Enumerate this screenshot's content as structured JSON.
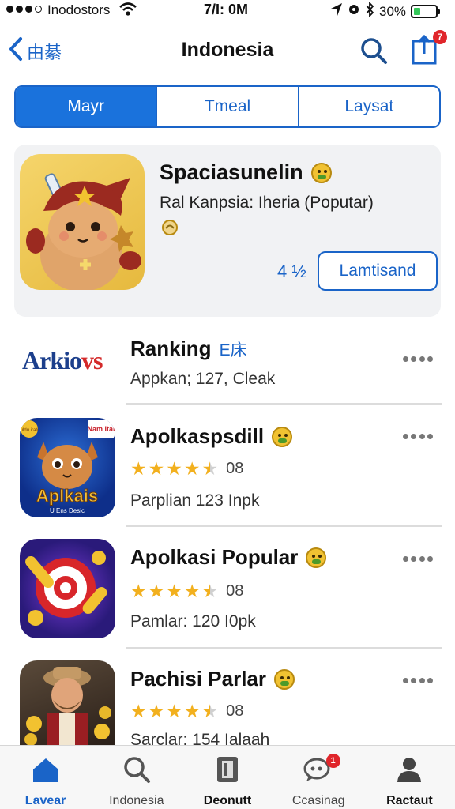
{
  "status_bar": {
    "carrier": "Inodostors",
    "time": "7/I: 0M",
    "battery": "30%",
    "battery_level": 0.3
  },
  "nav": {
    "back_label": "由綦",
    "title": "Indonesia",
    "share_badge": "7"
  },
  "segments": [
    {
      "label": "Mayr",
      "active": true
    },
    {
      "label": "Tmeal",
      "active": false
    },
    {
      "label": "Laysat",
      "active": false
    }
  ],
  "featured": {
    "title": "Spaciasunelin",
    "subtitle": "Ral Kanpsia:  Iheria (Poputar)",
    "rating": "4 ½",
    "button_label": "Lamtisand"
  },
  "list": [
    {
      "title": "Ranking",
      "tag": "E床",
      "subtitle": "Appkan; 127, Cleak",
      "logo_text_blue": "Arkio",
      "logo_text_red": "vs"
    },
    {
      "title": "Apolkaspsdill",
      "rating": 4.5,
      "count": "08",
      "subtitle": "Parplian 123  Inpk",
      "icon_text": "Aplkais",
      "icon_badge": "Nam Itai",
      "icon_corner": "uldu irati",
      "icon_caption": "U Ens Desic"
    },
    {
      "title": "Apolkasi Popular",
      "rating": 4.5,
      "count": "08",
      "subtitle": "Pamlar:  120  I0pk"
    },
    {
      "title": "Pachisi Parlar",
      "rating": 4.5,
      "count": "08",
      "subtitle": "Sarclar:  154  Ialaah"
    }
  ],
  "tabs": [
    {
      "label": "Lavear",
      "icon": "home-icon"
    },
    {
      "label": "Indonesia",
      "icon": "search-icon"
    },
    {
      "label": "Deonutt",
      "icon": "book-icon"
    },
    {
      "label": "Ccasinag",
      "icon": "chat-icon",
      "badge": "1"
    },
    {
      "label": "Ractaut",
      "icon": "person-icon"
    }
  ],
  "colors": {
    "accent": "#1a64c8",
    "segment_active": "#1a72dc",
    "badge": "#e0262b",
    "star": "#f2b01e",
    "battery": "#34c759"
  }
}
